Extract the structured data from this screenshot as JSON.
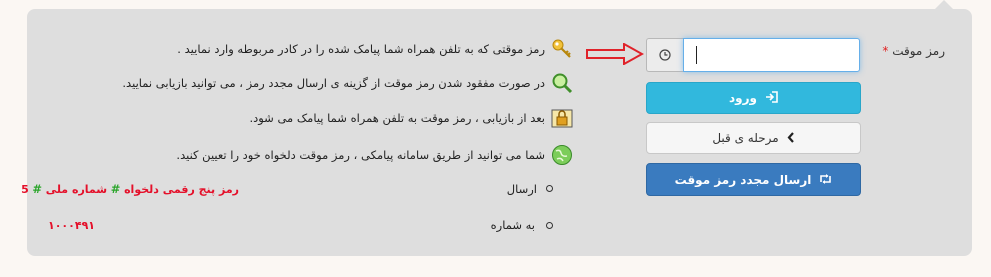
{
  "form": {
    "label": "رمز موقت",
    "required_mark": "*",
    "addon_icon": "clock-icon",
    "input_value": "",
    "login_label": "ورود",
    "login_icon": "sign-in-icon",
    "prev_label": "مرحله ی قبل",
    "prev_icon": "chevron-left-icon",
    "resend_label": "ارسال مجدد رمز موقت",
    "resend_icon": "retweet-icon"
  },
  "info": [
    {
      "text": "رمز موقتی که به تلفن همراه شما پیامک شده را در کادر مربوطه وارد نمایید .",
      "icon": "key-icon"
    },
    {
      "text": "در صورت مفقود شدن رمز موقت از گزینه ی ارسال مجدد رمز ، می توانید بازیابی نمایید.",
      "icon": "magnifier-icon"
    },
    {
      "text": "بعد از بازیابی ، رمز موقت به تلفن همراه شما پیامک می شود.",
      "icon": "lock-icon"
    },
    {
      "text": "شما می توانید از طریق سامانه پیامکی ، رمز موقت دلخواه خود را تعیین کنید.",
      "icon": "globe-icon"
    }
  ],
  "sms": {
    "send_label": "ارسال",
    "format_part1": "رمز پنج رقمی دلخواه",
    "hash1": "#",
    "format_part2": "شماره ملی",
    "hash2": "#",
    "format_part3": "5",
    "to_number_label": "به شماره",
    "number": "۱۰۰۰۴۹۱"
  },
  "colors": {
    "login": "#31b8dd",
    "resend": "#3a7bbf",
    "accent_red": "#e4102a",
    "accent_green": "#2aa52a"
  }
}
